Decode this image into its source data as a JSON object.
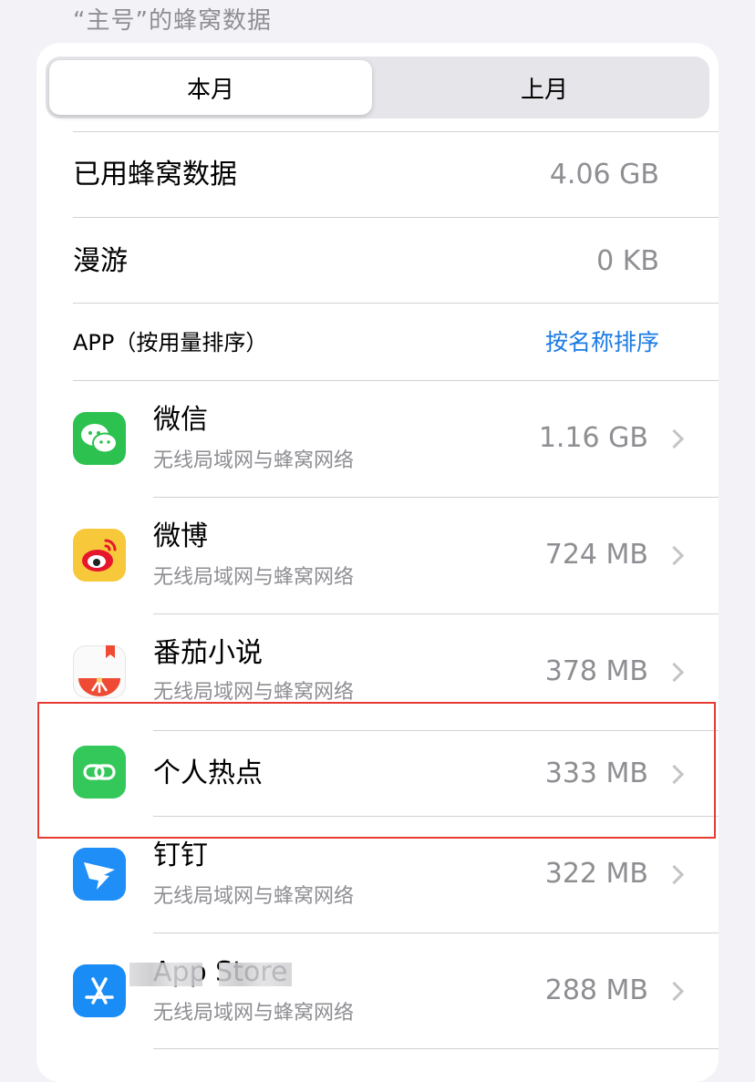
{
  "section_header": "“主号”的蜂窝数据",
  "segments": {
    "current": "本月",
    "last": "上月"
  },
  "usage": {
    "used_label": "已用蜂窝数据",
    "used_value": "4.06 GB",
    "roaming_label": "漫游",
    "roaming_value": "0 KB"
  },
  "apps_header": {
    "title": "APP（按用量排序）",
    "sort_link": "按名称排序"
  },
  "apps": [
    {
      "name": "微信",
      "subtitle": "无线局域网与蜂窝网络",
      "size": "1.16 GB",
      "icon": "wechat-icon"
    },
    {
      "name": "微博",
      "subtitle": "无线局域网与蜂窝网络",
      "size": "724 MB",
      "icon": "weibo-icon"
    },
    {
      "name": "番茄小说",
      "subtitle": "无线局域网与蜂窝网络",
      "size": "378 MB",
      "icon": "fanqie-icon"
    },
    {
      "name": "个人热点",
      "subtitle": "",
      "size": "333 MB",
      "icon": "hotspot-icon"
    },
    {
      "name": "钉钉",
      "subtitle": "无线局域网与蜂窝网络",
      "size": "322 MB",
      "icon": "dingtalk-icon"
    },
    {
      "name": "App Store",
      "subtitle": "无线局域网与蜂窝网络",
      "size": "288 MB",
      "icon": "appstore-icon"
    }
  ],
  "colors": {
    "accent_link": "#1a7be5",
    "highlight": "#e63a32",
    "wechat": "#2dc14f",
    "hotspot": "#34c759"
  }
}
